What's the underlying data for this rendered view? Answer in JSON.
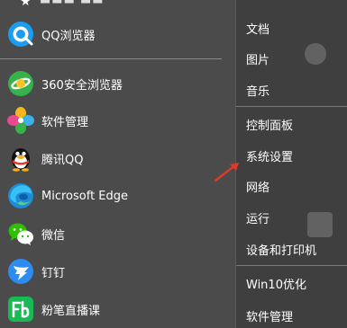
{
  "left_menu": {
    "top_partial_text": "■■■ ■■",
    "items": [
      {
        "label": "QQ浏览器",
        "icon": "qq-browser-icon"
      },
      {
        "label": "360安全浏览器",
        "icon": "360-browser-icon"
      },
      {
        "label": "软件管理",
        "icon": "software-manager-icon"
      },
      {
        "label": "腾讯QQ",
        "icon": "qq-penguin-icon"
      },
      {
        "label": "Microsoft Edge",
        "icon": "edge-icon"
      },
      {
        "label": "微信",
        "icon": "wechat-icon"
      },
      {
        "label": "钉钉",
        "icon": "dingtalk-icon"
      },
      {
        "label": "粉笔直播课",
        "icon": "fenbi-icon"
      }
    ]
  },
  "right_menu": {
    "items": [
      {
        "label": "文档"
      },
      {
        "label": "图片"
      },
      {
        "label": "音乐"
      },
      {
        "label": "控制面板"
      },
      {
        "label": "系统设置"
      },
      {
        "label": "网络"
      },
      {
        "label": "运行"
      },
      {
        "label": "设备和打印机"
      },
      {
        "label": "Win10优化"
      },
      {
        "label": "软件管理"
      }
    ]
  },
  "annotation": {
    "arrow_color": "#e0392b"
  },
  "colors": {
    "left_bg": "#4b4b4b",
    "right_bg": "#3f3f3f",
    "text": "#ffffff"
  }
}
